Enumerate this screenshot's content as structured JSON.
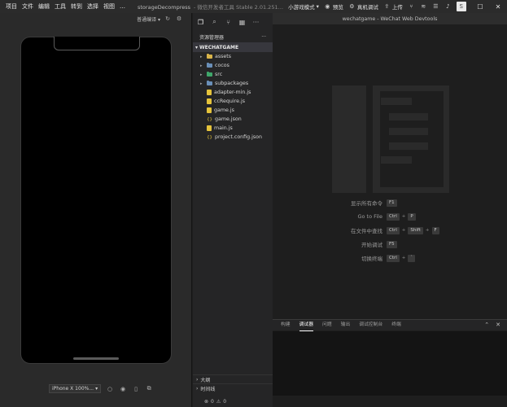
{
  "menu": [
    "项目",
    "文件",
    "编辑",
    "工具",
    "转到",
    "选择",
    "视图",
    "…"
  ],
  "title": {
    "project": "storageDecompress",
    "app": "- 微信开发者工具 Stable 2.01.251…"
  },
  "mode_select": "小游戏模式",
  "toolbar": {
    "preview": "预览",
    "real_debug": "真机调试",
    "upload": "上传",
    "square_glyph": "S"
  },
  "simulator": {
    "compile_select": "普通编译",
    "device_select": "iPhone X 100%..."
  },
  "editor": {
    "title": "wechatgame - WeChat Web Devtools"
  },
  "explorer": {
    "header": "资源管理器",
    "more": "···",
    "root": "WECHATGAME",
    "folders": [
      {
        "name": "assets",
        "color": "#d9b44a"
      },
      {
        "name": "cocos",
        "color": "#6a8fb8"
      },
      {
        "name": "src",
        "color": "#3fa66a"
      },
      {
        "name": "subpackages",
        "color": "#6a8fb8"
      }
    ],
    "files": [
      {
        "name": "adapter-min.js",
        "type": "js"
      },
      {
        "name": "ccRequire.js",
        "type": "js"
      },
      {
        "name": "game.js",
        "type": "js"
      },
      {
        "name": "game.json",
        "type": "json"
      },
      {
        "name": "main.js",
        "type": "js"
      },
      {
        "name": "project.config.json",
        "type": "json"
      }
    ],
    "sections": [
      "大纲",
      "时间线"
    ],
    "status": {
      "errors": "0",
      "warnings": "0"
    }
  },
  "shortcuts": [
    {
      "label": "显示所有命令",
      "keys": [
        "F1"
      ]
    },
    {
      "label": "Go to File",
      "keys": [
        "Ctrl",
        "P"
      ]
    },
    {
      "label": "在文件中查找",
      "keys": [
        "Ctrl",
        "Shift",
        "F"
      ]
    },
    {
      "label": "开始调试",
      "keys": [
        "F5"
      ]
    },
    {
      "label": "切换终端",
      "keys": [
        "Ctrl",
        "`"
      ]
    }
  ],
  "panel": {
    "tabs": [
      "构建",
      "调试器",
      "问题",
      "输出",
      "调试控制台",
      "终端"
    ],
    "active_tab": "调试器"
  }
}
